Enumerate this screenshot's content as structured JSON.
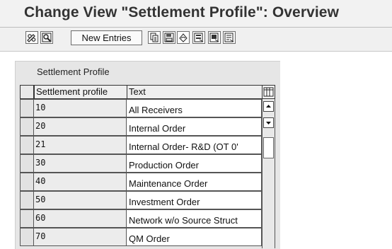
{
  "window": {
    "title": "Change View \"Settlement Profile\": Overview"
  },
  "toolbar": {
    "buttons": [
      {
        "name": "display-change-icon"
      },
      {
        "name": "details-icon"
      },
      {
        "name": "copy-as-icon"
      },
      {
        "name": "save-icon"
      },
      {
        "name": "undo-change-icon"
      },
      {
        "name": "select-all-icon"
      },
      {
        "name": "select-block-icon"
      },
      {
        "name": "deselect-all-icon"
      }
    ],
    "new_entries_label": "New Entries"
  },
  "table": {
    "title": "Settlement Profile",
    "columns": [
      "Settlement profile",
      "Text"
    ],
    "rows": [
      {
        "key": "10",
        "text": "All Receivers"
      },
      {
        "key": "20",
        "text": "Internal Order"
      },
      {
        "key": "21",
        "text": "Internal Order- R&D (OT 0'"
      },
      {
        "key": "30",
        "text": "Production Order"
      },
      {
        "key": "40",
        "text": "Maintenance Order"
      },
      {
        "key": "50",
        "text": "Investment Order"
      },
      {
        "key": "60",
        "text": "Network w/o Source Struct"
      },
      {
        "key": "70",
        "text": "QM Order"
      }
    ]
  }
}
